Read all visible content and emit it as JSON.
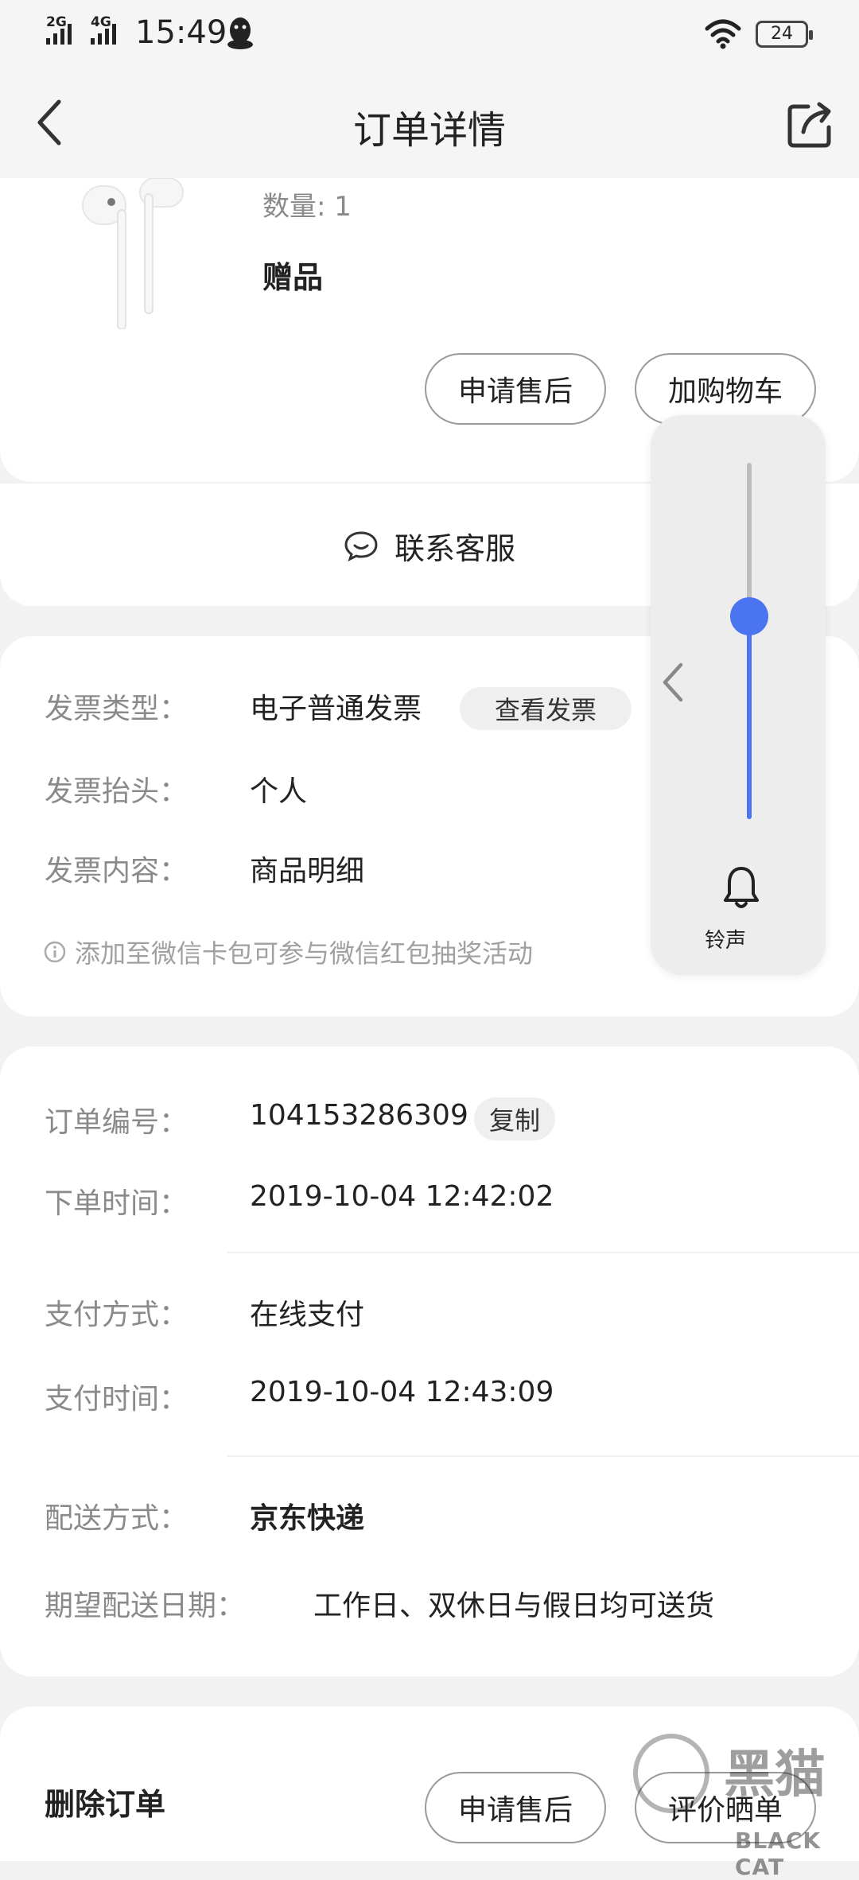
{
  "status_bar": {
    "network1": "2G",
    "network2": "4G",
    "time": "15:49",
    "battery": "24"
  },
  "header": {
    "title": "订单详情"
  },
  "product": {
    "quantity": "数量: 1",
    "tag": "赠品",
    "after_sale_button": "申请售后",
    "add_cart_button": "加购物车"
  },
  "service": {
    "contact_label": "联系客服"
  },
  "invoice": {
    "type_label": "发票类型：",
    "type_value": "电子普通发票",
    "view_button": "查看发票",
    "title_label": "发票抬头：",
    "title_value": "个人",
    "content_label": "发票内容：",
    "content_value": "商品明细",
    "wechat_tip": "添加至微信卡包可参与微信红包抽奖活动"
  },
  "order": {
    "number_label": "订单编号：",
    "number_value": "104153286309",
    "copy_button": "复制",
    "time_label": "下单时间：",
    "time_value": "2019-10-04 12:42:02",
    "pay_method_label": "支付方式：",
    "pay_method_value": "在线支付",
    "pay_time_label": "支付时间：",
    "pay_time_value": "2019-10-04 12:43:09",
    "delivery_label": "配送方式：",
    "delivery_value": "京东快递",
    "expect_label": "期望配送日期：",
    "expect_value": "工作日、双休日与假日均可送货"
  },
  "footer": {
    "delete_label": "删除订单",
    "after_sale_button": "申请售后",
    "review_button": "评价晒单"
  },
  "volume_overlay": {
    "label": "铃声",
    "level": 0.57,
    "accent": "#4a74f0"
  },
  "watermark": {
    "cn": "黑猫",
    "en": "BLACK CAT"
  }
}
